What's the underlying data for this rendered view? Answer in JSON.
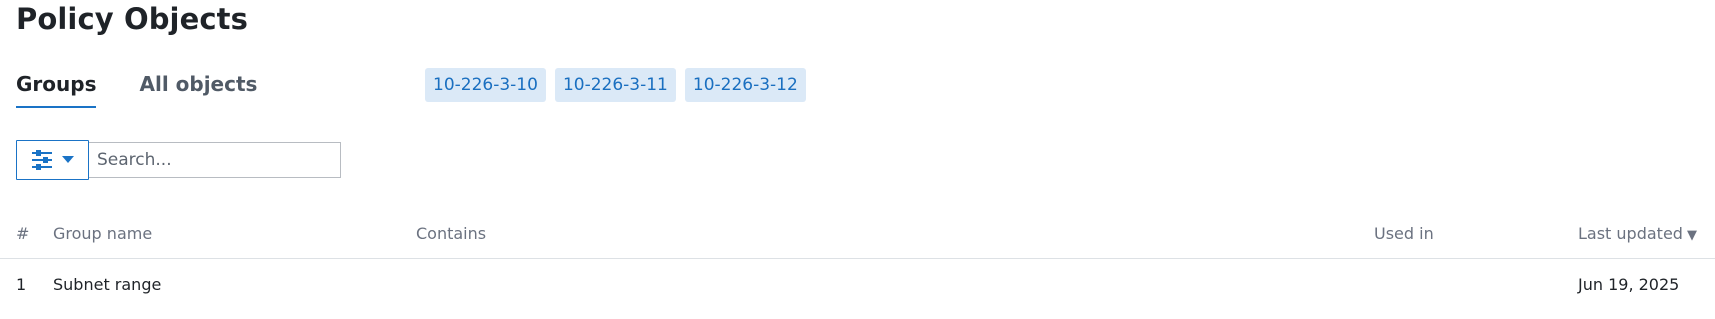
{
  "page": {
    "title": "Policy Objects"
  },
  "tabs": [
    {
      "label": "Groups",
      "active": true
    },
    {
      "label": "All objects",
      "active": false
    }
  ],
  "toolbar": {
    "filter_icon": "sliders-icon",
    "dropdown_icon": "caret-down-icon",
    "search_placeholder": "Search..."
  },
  "table": {
    "columns": {
      "index": "#",
      "group_name": "Group name",
      "contains": "Contains",
      "used_in": "Used in",
      "last_updated": "Last updated",
      "sort_glyph": "▼"
    },
    "rows": [
      {
        "index": "1",
        "group_name": "Subnet range",
        "contains": [
          "10-226-3-10",
          "10-226-3-11",
          "10-226-3-12"
        ],
        "used_in": "",
        "last_updated": "Jun 19, 2025"
      }
    ]
  },
  "colors": {
    "accent": "#1a73c6",
    "tag_bg": "#dbe9f7",
    "tag_text": "#1a6fc0",
    "muted": "#6b7280"
  }
}
